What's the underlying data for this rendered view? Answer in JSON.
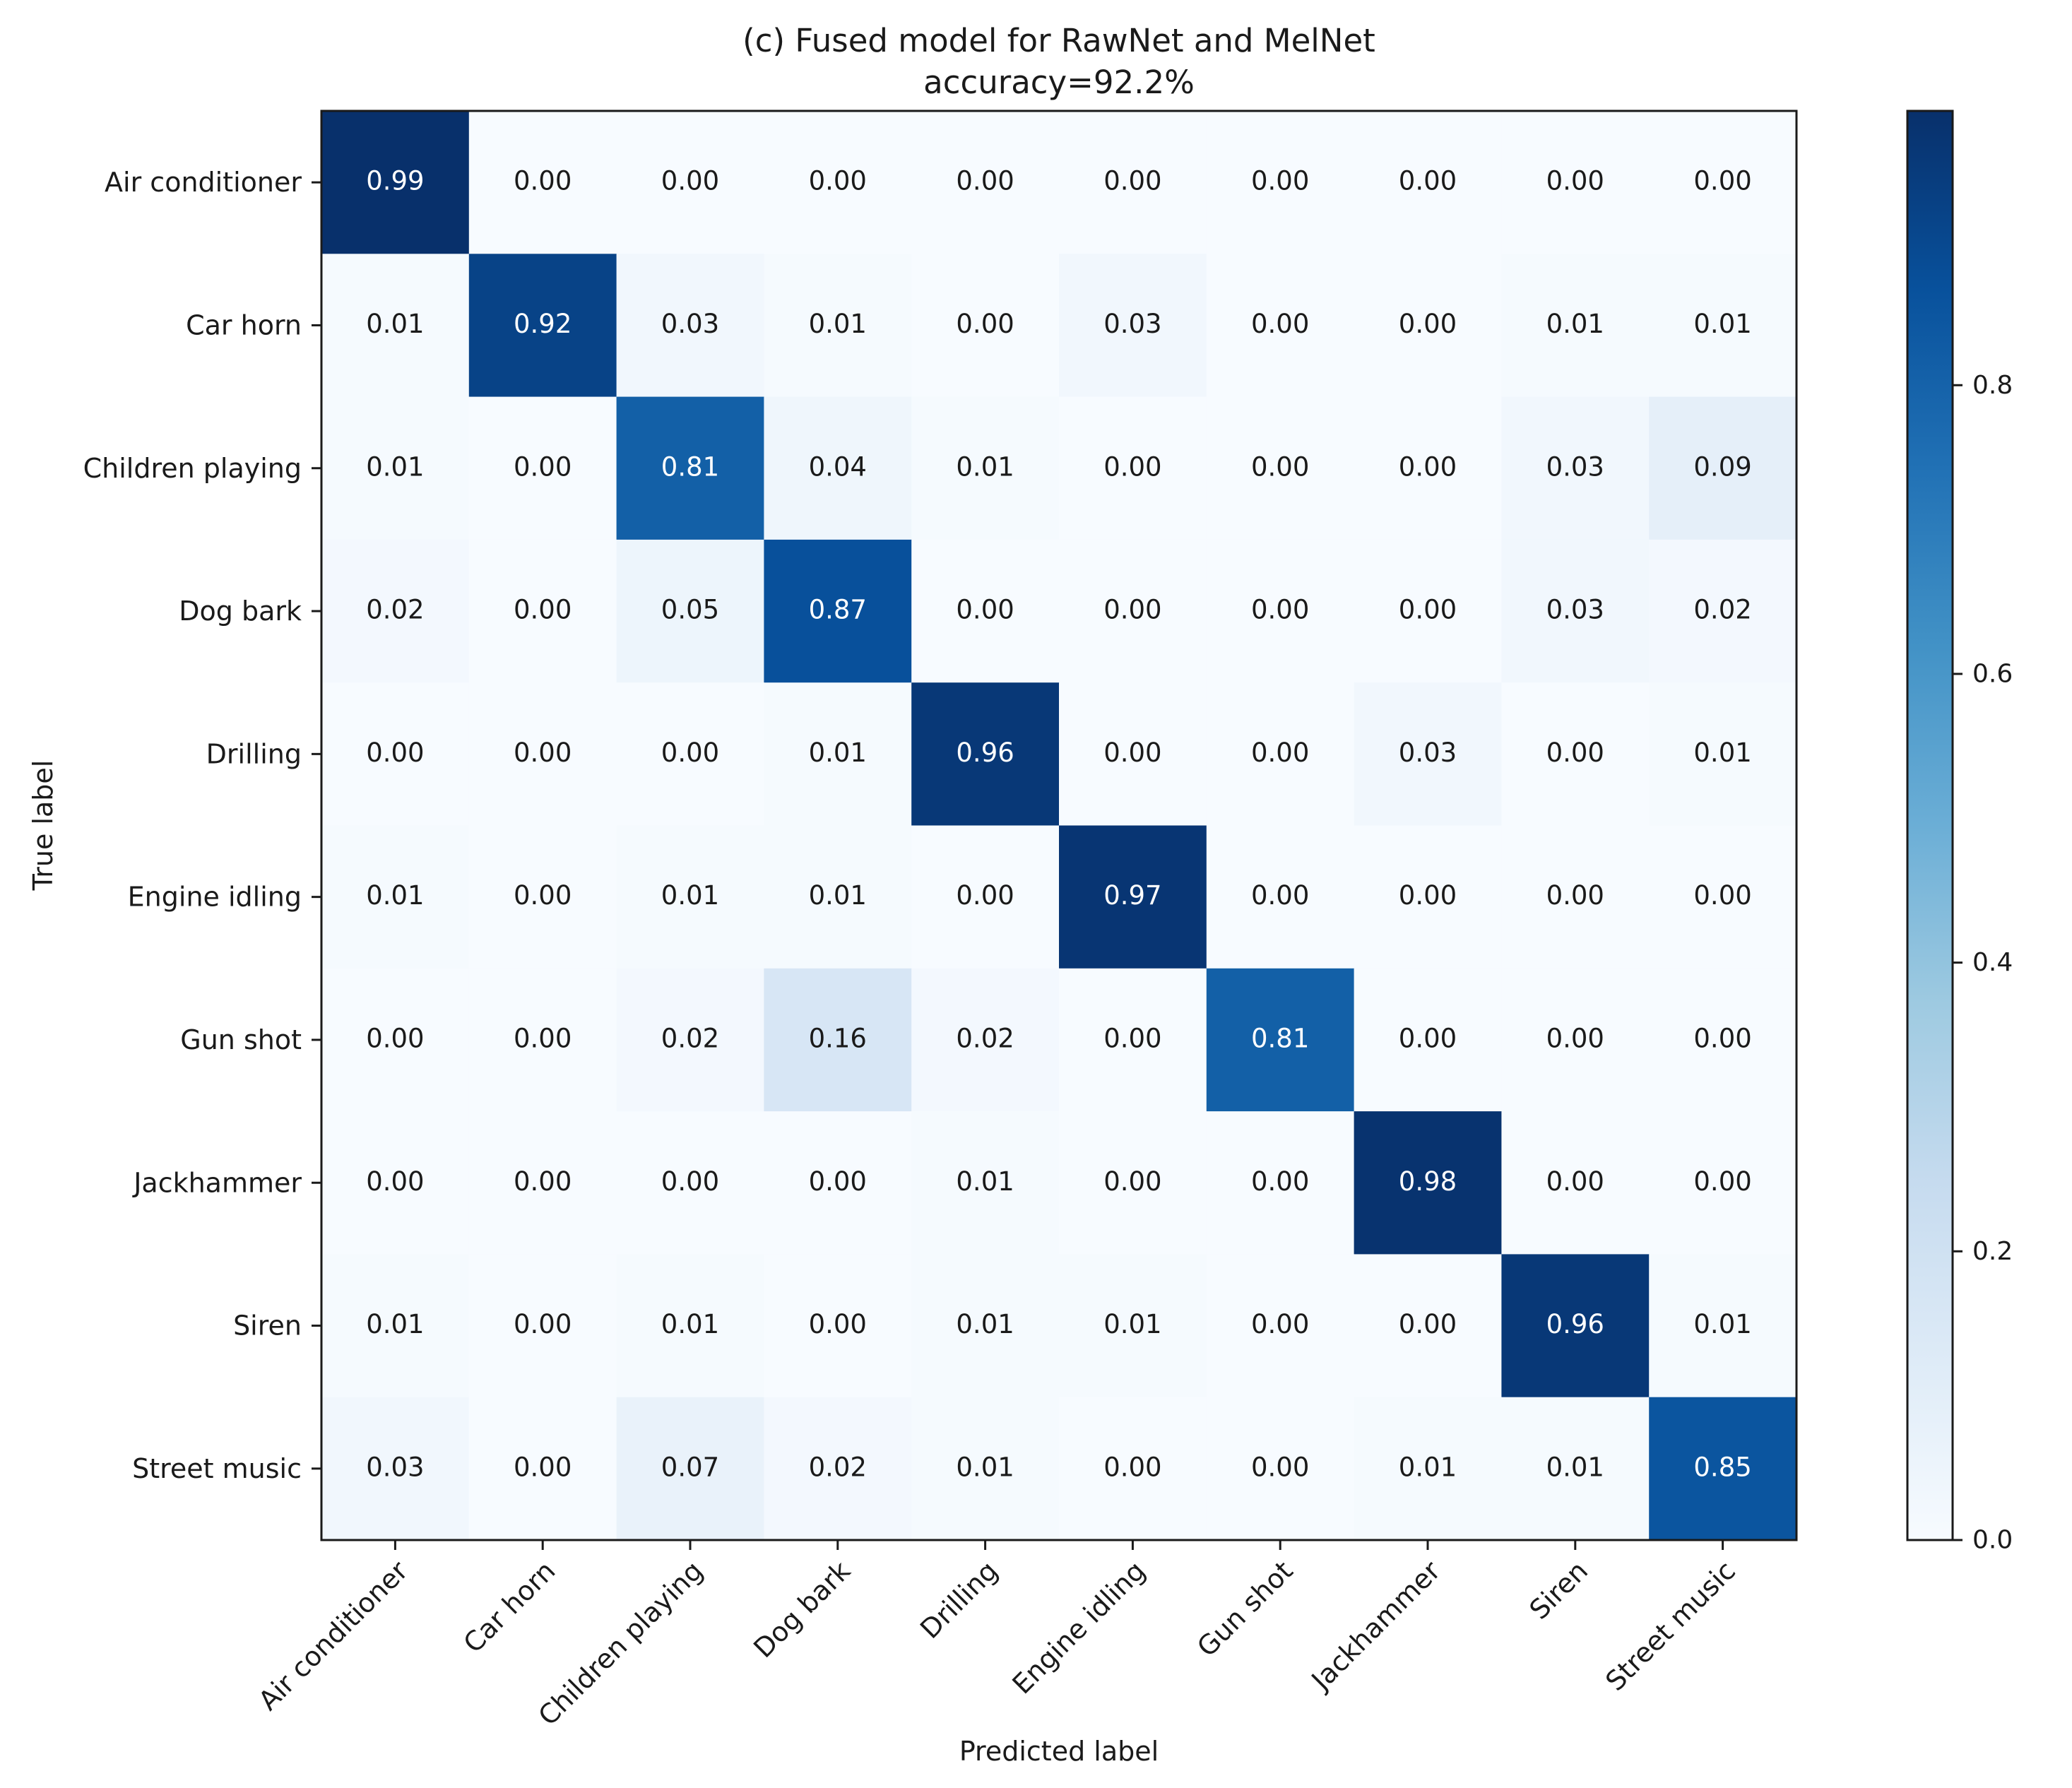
{
  "chart_data": {
    "type": "heatmap",
    "title": "(c) Fused model for RawNet and MelNet",
    "subtitle": "accuracy=92.2%",
    "xlabel": "Predicted label",
    "ylabel": "True label",
    "x_categories": [
      "Air conditioner",
      "Car horn",
      "Children playing",
      "Dog bark",
      "Drilling",
      "Engine idling",
      "Gun shot",
      "Jackhammer",
      "Siren",
      "Street music"
    ],
    "y_categories": [
      "Air conditioner",
      "Car horn",
      "Children playing",
      "Dog bark",
      "Drilling",
      "Engine idling",
      "Gun shot",
      "Jackhammer",
      "Siren",
      "Street music"
    ],
    "values": [
      [
        0.99,
        0.0,
        0.0,
        0.0,
        0.0,
        0.0,
        0.0,
        0.0,
        0.0,
        0.0
      ],
      [
        0.01,
        0.92,
        0.03,
        0.01,
        0.0,
        0.03,
        0.0,
        0.0,
        0.01,
        0.01
      ],
      [
        0.01,
        0.0,
        0.81,
        0.04,
        0.01,
        0.0,
        0.0,
        0.0,
        0.03,
        0.09
      ],
      [
        0.02,
        0.0,
        0.05,
        0.87,
        0.0,
        0.0,
        0.0,
        0.0,
        0.03,
        0.02
      ],
      [
        0.0,
        0.0,
        0.0,
        0.01,
        0.96,
        0.0,
        0.0,
        0.03,
        0.0,
        0.01
      ],
      [
        0.01,
        0.0,
        0.01,
        0.01,
        0.0,
        0.97,
        0.0,
        0.0,
        0.0,
        0.0
      ],
      [
        0.0,
        0.0,
        0.02,
        0.16,
        0.02,
        0.0,
        0.81,
        0.0,
        0.0,
        0.0
      ],
      [
        0.0,
        0.0,
        0.0,
        0.0,
        0.01,
        0.0,
        0.0,
        0.98,
        0.0,
        0.0
      ],
      [
        0.01,
        0.0,
        0.01,
        0.0,
        0.01,
        0.01,
        0.0,
        0.0,
        0.96,
        0.01
      ],
      [
        0.03,
        0.0,
        0.07,
        0.02,
        0.01,
        0.0,
        0.0,
        0.01,
        0.01,
        0.85
      ]
    ],
    "value_format": "0.00",
    "colormap": "Blues",
    "colormap_stops": [
      "#f7fbff",
      "#deebf7",
      "#c6dbef",
      "#9ecae1",
      "#6baed6",
      "#4292c6",
      "#2171b5",
      "#08519c",
      "#08306b"
    ],
    "text_color_dark": "#1a1a1a",
    "text_color_light": "#ffffff",
    "text_threshold": 0.5,
    "colorbar": {
      "range": [
        0.0,
        0.99
      ],
      "ticks": [
        0.0,
        0.2,
        0.4,
        0.6,
        0.8
      ],
      "tick_labels": [
        "0.0",
        "0.2",
        "0.4",
        "0.6",
        "0.8"
      ],
      "placement": "right"
    },
    "grid": false,
    "legend": "none"
  }
}
